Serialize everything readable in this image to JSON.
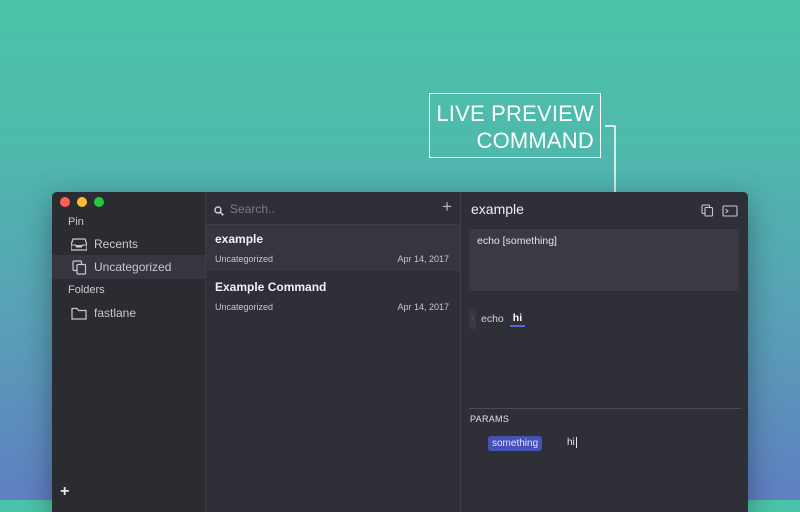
{
  "callout": {
    "line1": "LIVE PREVIEW",
    "line2": "COMMAND"
  },
  "window": {
    "controls": [
      "close",
      "minimize",
      "zoom"
    ]
  },
  "sidebar": {
    "pin_label": "Pin",
    "items": [
      {
        "label": "Recents",
        "icon": "inbox-icon"
      },
      {
        "label": "Uncategorized",
        "icon": "copy-icon",
        "active": true
      }
    ],
    "folders_label": "Folders",
    "folders": [
      {
        "label": "fastlane",
        "icon": "folder-icon"
      }
    ],
    "add_label": "+"
  },
  "list": {
    "search_placeholder": "Search..",
    "add_label": "+",
    "commands": [
      {
        "title": "example",
        "category": "Uncategorized",
        "date": "Apr 14, 2017"
      },
      {
        "title": "Example Command",
        "category": "Uncategorized",
        "date": "Apr 14, 2017"
      }
    ]
  },
  "detail": {
    "title": "example",
    "command_text": "echo [something]",
    "preview": {
      "text": "echo",
      "param_value": "hi"
    },
    "params_label": "PARAMS",
    "params": [
      {
        "name": "something",
        "value": "hi"
      }
    ]
  },
  "colors": {
    "accent": "#4651b8",
    "background_top": "#4ac3a7",
    "background_bottom": "#5f7fc2"
  }
}
